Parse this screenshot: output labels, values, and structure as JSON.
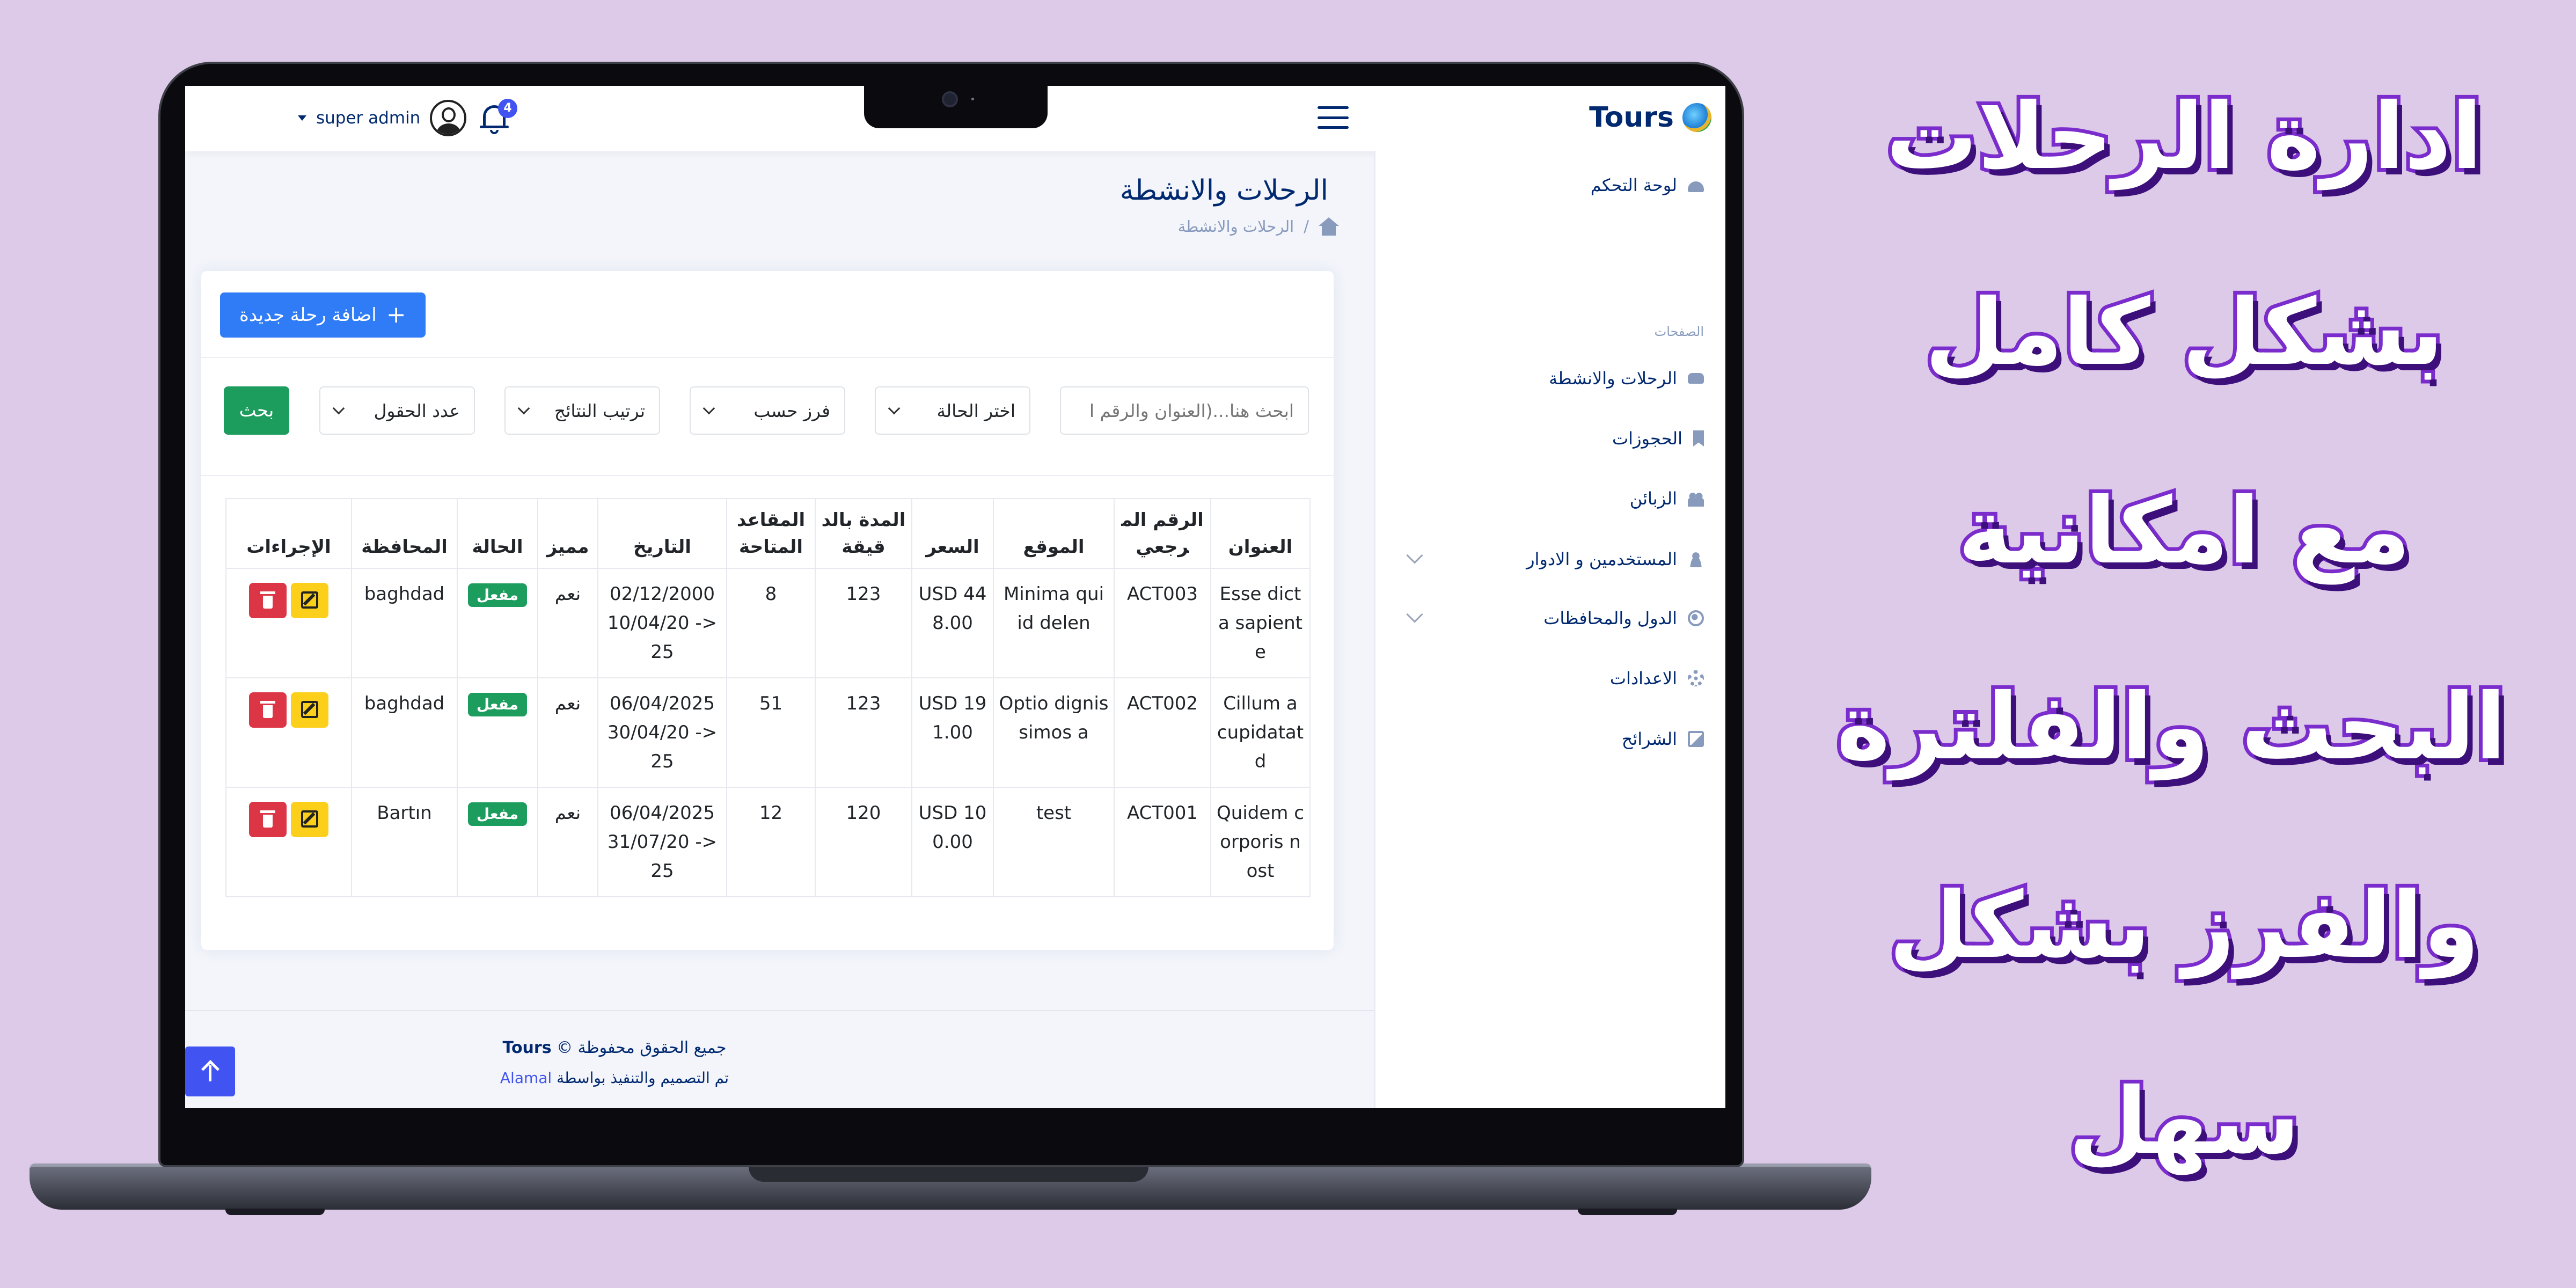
{
  "colors": {
    "background": "#ddc9e8",
    "brand": "#012970",
    "primary": "#2f7cf6",
    "success": "#1c9c5d",
    "danger": "#dc3545",
    "warning": "#fccf1b",
    "promo_text": "#ffffff",
    "promo_stroke": "#7b2ccc"
  },
  "promo": {
    "lines": [
      "ادارة الرحلات",
      "بشكل كامل",
      "مع امكانية",
      "البحث والفلترة",
      "والفرز بشكل",
      "سهل"
    ]
  },
  "topbar": {
    "brand": "Tours",
    "brand_logo": "globe-logo",
    "notification_count": "4",
    "notification_icon": "bell-icon",
    "user_name": "super admin",
    "avatar_icon": "user-avatar-icon",
    "menu_icon": "hamburger-icon"
  },
  "sidebar": {
    "items": [
      {
        "label": "لوحة التحكم",
        "icon": "dashboard-icon"
      },
      {
        "label": "الرحلات والانشطة",
        "icon": "car-icon"
      },
      {
        "label": "الحجوزات",
        "icon": "bookmark-icon"
      },
      {
        "label": "الزبائن",
        "icon": "people-icon"
      },
      {
        "label": "المستخدمين و الادوار",
        "icon": "person-icon"
      },
      {
        "label": "الدول والمحافظات",
        "icon": "globe-icon"
      },
      {
        "label": "الاعدادات",
        "icon": "gear-icon"
      },
      {
        "label": "الشرائح",
        "icon": "image-icon"
      }
    ],
    "heading": "الصفحات"
  },
  "page": {
    "title": "الرحلات والانشطة",
    "breadcrumb": "الرحلات والانشطة",
    "breadcrumb_sep": "/"
  },
  "toolbar": {
    "add_button": "اضافة رحلة جديدة"
  },
  "filters": {
    "search_placeholder": "ابحث هنا...(العنوان والرقم ا",
    "status": "اختر الحالة",
    "sort_by": "فرز حسب",
    "order": "ترتيب النتائج",
    "count": "عدد الحقول",
    "search_button": "بحث"
  },
  "table": {
    "headers": [
      "العنوان",
      "الرقم المرجعي",
      "الموقع",
      "السعر",
      "المدة بالدقيقة",
      "المقاعد المتاحة",
      "التاريخ",
      "مميز",
      "الحالة",
      "المحافظة",
      "الإجراءات"
    ],
    "rows": [
      [
        "Esse dicta sapiente",
        "ACT003",
        "Minima qui id delen",
        "USD 448.00",
        "123",
        "8",
        "02/12/2000 <- 10/04/2025",
        "نعم",
        "مفعل",
        "baghdad"
      ],
      [
        "Cillum a cupidatat d",
        "ACT002",
        "Optio dignissimos a",
        "USD 191.00",
        "123",
        "51",
        "06/04/2025 <- 30/04/2025",
        "نعم",
        "مفعل",
        "baghdad"
      ],
      [
        "Quidem corporis nost",
        "ACT001",
        "test",
        "USD 100.00",
        "120",
        "12",
        "06/04/2025 <- 31/07/2025",
        "نعم",
        "مفعل",
        "Bartın"
      ]
    ]
  },
  "footer": {
    "copyright_prefix": "جميع الحقوق محفوظة ©",
    "copyright_brand": "Tours",
    "credit_prefix": "تم التصميم والتنفيذ بواسطة",
    "credit_link": "Alamal"
  }
}
